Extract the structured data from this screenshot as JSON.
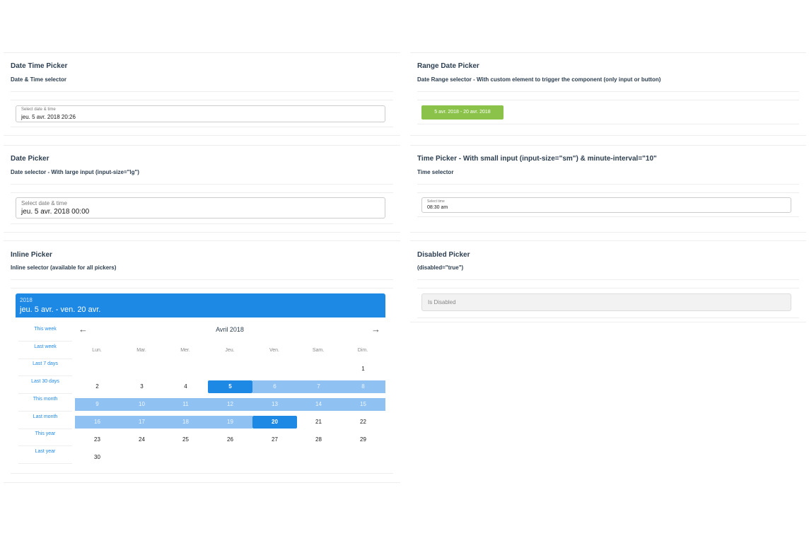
{
  "cards": {
    "datetime": {
      "title": "Date Time Picker",
      "subtitle": "Date & Time selector",
      "label": "Select date & time",
      "value": "jeu. 5 avr. 2018 20:26"
    },
    "range": {
      "title": "Range Date Picker",
      "subtitle": "Date Range selector - With custom element to trigger the component (only input or button)",
      "button": "5 avr. 2018 - 20 avr. 2018"
    },
    "date": {
      "title": "Date Picker",
      "subtitle": "Date selector - With large input (input-size=\"lg\")",
      "label": "Select date & time",
      "value": "jeu. 5 avr. 2018 00:00"
    },
    "time": {
      "title": "Time Picker - With small input (input-size=\"sm\") & minute-interval=\"10\"",
      "subtitle": "Time selector",
      "label": "Select time",
      "value": "08:30 am"
    },
    "inline": {
      "title": "Inline Picker",
      "subtitle": "Inline selector (available for all pickers)"
    },
    "disabled": {
      "title": "Disabled Picker",
      "subtitle": "(disabled=\"true\")",
      "placeholder": "Is Disabled"
    }
  },
  "calendar": {
    "year": "2018",
    "range_text": "jeu. 5 avr. - ven. 20 avr.",
    "month": "Avril 2018",
    "prev": "←",
    "next": "→",
    "weekdays": [
      "Lun.",
      "Mar.",
      "Mer.",
      "Jeu.",
      "Ven.",
      "Sam.",
      "Dim."
    ],
    "shortcuts": [
      "This week",
      "Last week",
      "Last 7 days",
      "Last 30 days",
      "This month",
      "Last month",
      "This year",
      "Last year"
    ],
    "days": [
      "1",
      "2",
      "3",
      "4",
      "5",
      "6",
      "7",
      "8",
      "9",
      "10",
      "11",
      "12",
      "13",
      "14",
      "15",
      "16",
      "17",
      "18",
      "19",
      "20",
      "21",
      "22",
      "23",
      "24",
      "25",
      "26",
      "27",
      "28",
      "29",
      "30"
    ],
    "first_weekday_index": 6,
    "range_start": 5,
    "range_end": 20
  },
  "colors": {
    "accent": "#1e88e5",
    "range": "#8fc1f2",
    "green": "#8bc34a"
  }
}
